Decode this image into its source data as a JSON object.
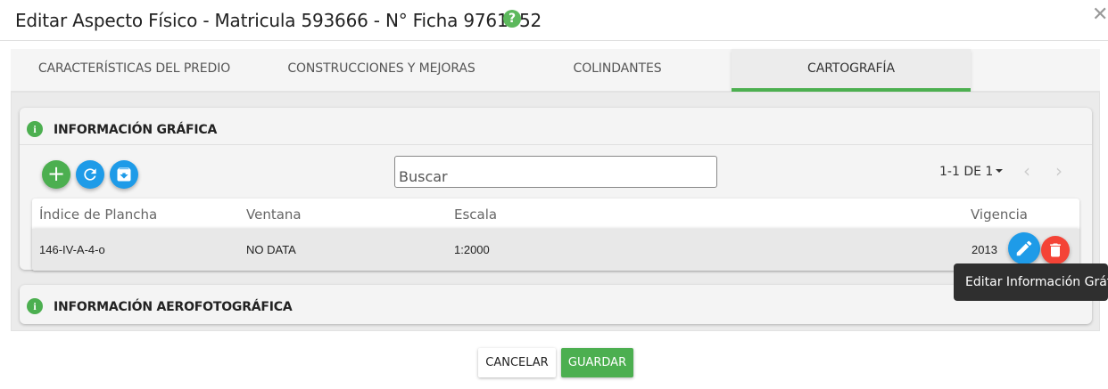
{
  "dialog": {
    "title": "Editar Aspecto Físico - Matricula 593666 - N° Ficha 9761952",
    "help_glyph": "?",
    "close_glyph": "✕"
  },
  "tabs": [
    {
      "label": "CARACTERÍSTICAS DEL PREDIO",
      "active": false
    },
    {
      "label": "CONSTRUCCIONES Y MEJORAS",
      "active": false
    },
    {
      "label": "COLINDANTES",
      "active": false
    },
    {
      "label": "CARTOGRAFÍA",
      "active": true
    }
  ],
  "grafica": {
    "title": "INFORMACIÓN GRÁFICA",
    "info_glyph": "i",
    "add_glyph": "+",
    "search_placeholder": "Buscar",
    "pagination": "1-1 DE 1",
    "prev_glyph": "‹",
    "next_glyph": "›",
    "columns": [
      "Índice de Plancha",
      "Ventana",
      "Escala",
      "Vigencia"
    ],
    "rows": [
      {
        "indice": "146-IV-A-4-o",
        "ventana": "NO DATA",
        "escala": "1:2000",
        "vigencia": "2013"
      }
    ]
  },
  "aero": {
    "title": "INFORMACIÓN AEROFOTOGRÁFICA",
    "info_glyph": "i"
  },
  "tooltip": "Editar Información Gráfica",
  "footer": {
    "cancel_label": "CANCELAR",
    "save_label": "GUARDAR"
  },
  "colors": {
    "accent_green": "#4caf50",
    "accent_blue": "#1e9be8",
    "danger_red": "#f44336"
  },
  "icons": {
    "help": "help-icon",
    "close": "close-icon",
    "info": "info-icon",
    "add": "plus-icon",
    "refresh": "refresh-icon",
    "archive": "archive-icon",
    "edit": "pencil-icon",
    "delete": "trash-icon"
  }
}
